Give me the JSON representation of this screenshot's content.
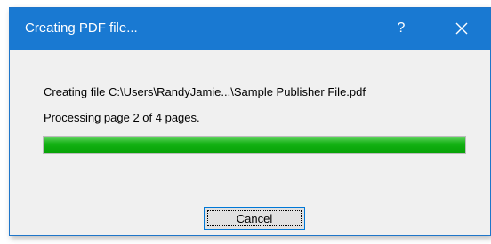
{
  "window": {
    "title": "Creating PDF file...",
    "help_label": "?",
    "close_icon": "close-icon",
    "titlebar_color": "#1979d2"
  },
  "body": {
    "file_message": "Creating file C:\\Users\\RandyJamie...\\Sample Publisher File.pdf",
    "page_message": "Processing page 2 of 4 pages."
  },
  "progress": {
    "fraction": 1.0,
    "color": "#12b012"
  },
  "buttons": {
    "cancel_label": "Cancel"
  }
}
